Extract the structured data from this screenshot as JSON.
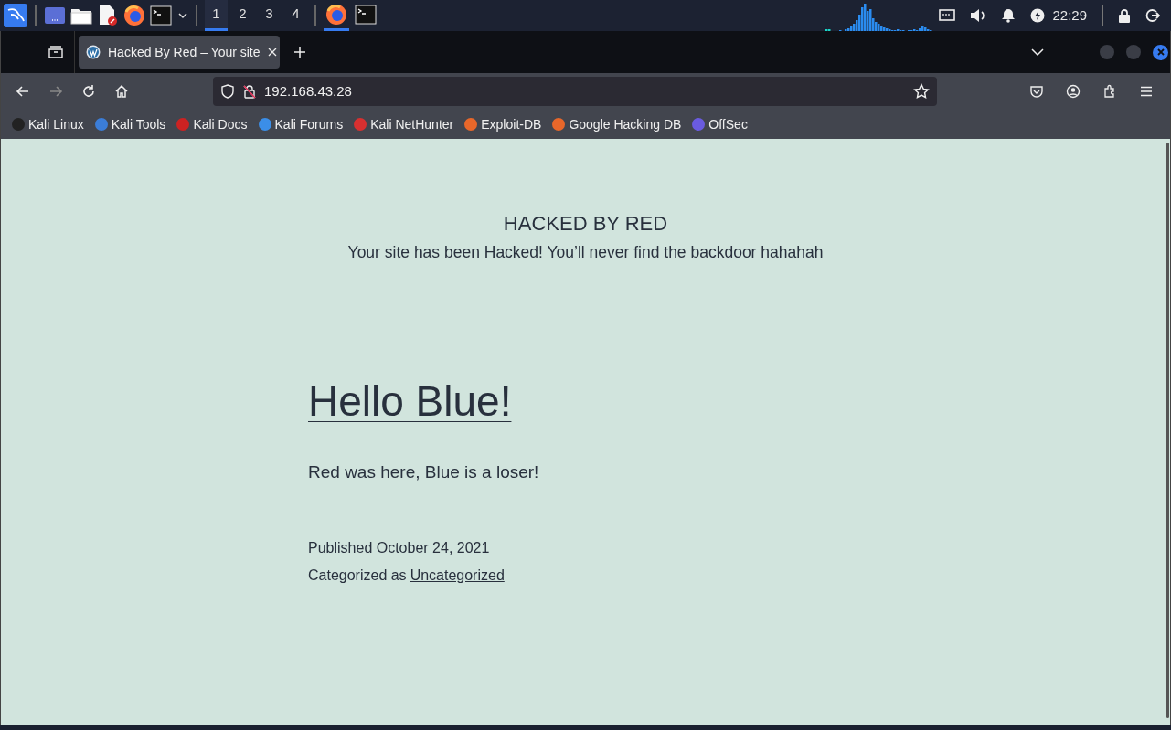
{
  "taskbar": {
    "apps": [
      {
        "kind": "menu"
      },
      {
        "kind": "desktop"
      },
      {
        "kind": "files"
      },
      {
        "kind": "editor"
      },
      {
        "kind": "browser"
      },
      {
        "kind": "terminal"
      }
    ],
    "workspaces": [
      {
        "label": "1",
        "selected": true
      },
      {
        "label": "2",
        "selected": false
      },
      {
        "label": "3",
        "selected": false
      },
      {
        "label": "4",
        "selected": false
      }
    ],
    "windows": [
      {
        "kind": "browser",
        "selected": true
      },
      {
        "kind": "terminal",
        "selected": false
      }
    ],
    "clock": "22:29"
  },
  "browser": {
    "tabs": [
      {
        "title": "Hacked By Red – Your site",
        "selected": true
      }
    ],
    "address": "192.168.43.28",
    "bookmarks": [
      {
        "label": "Kali Linux",
        "color": "#222222"
      },
      {
        "label": "Kali Tools",
        "color": "#3b7dd8"
      },
      {
        "label": "Kali Docs",
        "color": "#cc2222"
      },
      {
        "label": "Kali Forums",
        "color": "#3b8ee8"
      },
      {
        "label": "Kali NetHunter",
        "color": "#d83030"
      },
      {
        "label": "Exploit-DB",
        "color": "#e8672a"
      },
      {
        "label": "Google Hacking DB",
        "color": "#e8672a"
      },
      {
        "label": "OffSec",
        "color": "#6a5be0"
      }
    ]
  },
  "page": {
    "site_title": "HACKED BY RED",
    "tagline": "Your site has been Hacked! You’ll never find the backdoor hahahah",
    "post_title": "Hello Blue!",
    "post_body": "Red was here, Blue is a loser!",
    "published": "Published October 24, 2021",
    "category_prefix": "Categorized as",
    "category": "Uncategorized"
  }
}
